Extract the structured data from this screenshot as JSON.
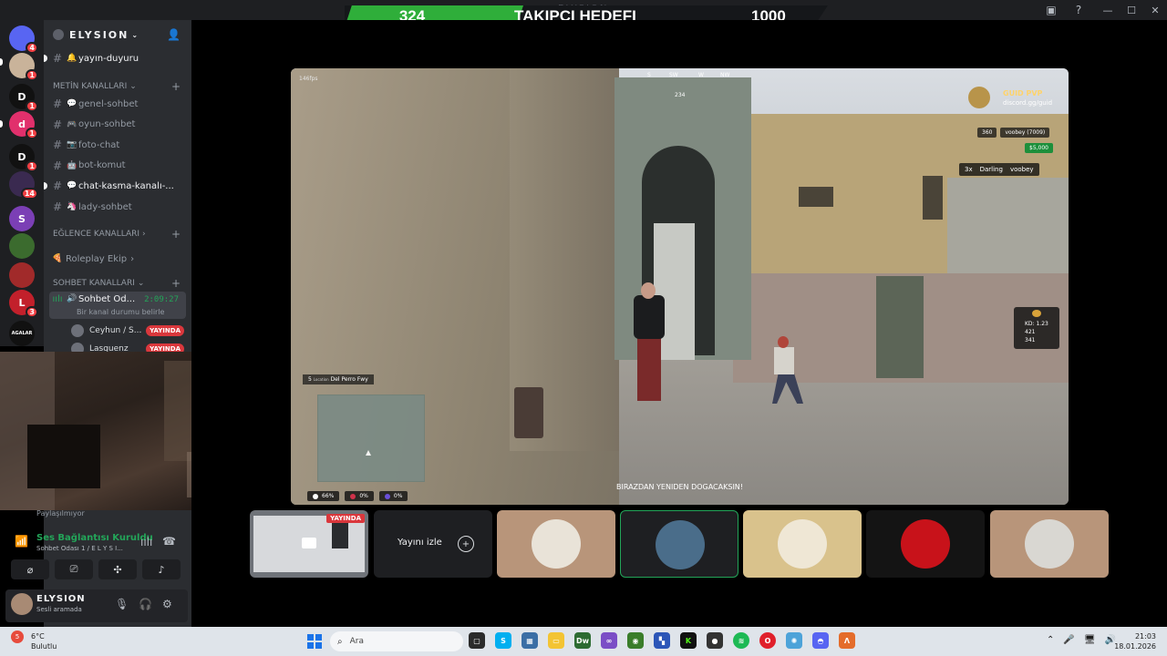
{
  "window": {
    "title_text": "ELYSION",
    "controls": [
      "—",
      "☐",
      "✕"
    ]
  },
  "overlay_goal": {
    "current": "324",
    "label": "TAKIPÇI HEDEFI",
    "target": "1000",
    "progress_fraction": 0.324,
    "fill_color": "#2fae3a"
  },
  "rail": {
    "items": [
      {
        "icon": "discord-icon",
        "badge": "4",
        "color": "#5865f2"
      },
      {
        "icon": "avatar",
        "badge": "1",
        "color": "#c9b39a"
      },
      {
        "icon": "server-d-yellow",
        "badge": "1",
        "color": "#111111",
        "text": "D"
      },
      {
        "icon": "server-tiktok",
        "badge": "1",
        "color": "#e1306c",
        "text": "d"
      },
      {
        "icon": "server-d-green",
        "badge": "1",
        "color": "#111111",
        "text": "D"
      },
      {
        "icon": "server-multi",
        "badge": "14",
        "color": "#3a2a50"
      },
      {
        "icon": "server-purple",
        "badge": "",
        "color": "#7b3fb5",
        "text": "S"
      },
      {
        "icon": "server-flower",
        "badge": "",
        "color": "#3b6b2e"
      },
      {
        "icon": "server-red-swirl",
        "badge": "",
        "color": "#a12a2a"
      },
      {
        "icon": "server-l",
        "badge": "3",
        "color": "#c2202b",
        "text": "L"
      },
      {
        "icon": "server-aga",
        "badge": "",
        "color": "#111111",
        "text": "AGALAR"
      }
    ]
  },
  "sidebar": {
    "server_name": "ELYSION",
    "announce_channel": "yayın-duyuru",
    "categories": {
      "text": "METİN KANALLARI",
      "fun": "EĞLENCE KANALLARI",
      "chat": "SOHBET KANALLARI"
    },
    "text_channels": [
      {
        "emoji": "💬",
        "name": "genel-sohbet",
        "unread": false
      },
      {
        "emoji": "🎮",
        "name": "oyun-sohbet",
        "unread": false
      },
      {
        "emoji": "📷",
        "name": "foto-chat",
        "unread": false
      },
      {
        "emoji": "🤖",
        "name": "bot-komut",
        "unread": false
      },
      {
        "emoji": "💬",
        "name": "chat-kasma-kanalı-...",
        "unread": true
      },
      {
        "emoji": "🦄",
        "name": "lady-sohbet",
        "unread": false
      }
    ],
    "roleplay_channel": "Roleplay Ekip",
    "voice_channel": {
      "name": "Sohbet Od...",
      "time": "2:09:27",
      "status": "Bir kanal durumu belirle"
    },
    "voice_users": [
      {
        "name": "Ceyhun / S...",
        "badge": "YAYINDA"
      },
      {
        "name": "Lasquenz",
        "badge": "YAYINDA"
      }
    ]
  },
  "user_area": {
    "share_status": "Paylaşılmıyor",
    "voice_connected": "Ses Bağlantısı Kuruldu",
    "voice_location": "Sohbet Odası 1 / E L Y S I...",
    "username": "ELYSION",
    "user_status": "Sesli aramada"
  },
  "stream": {
    "fps": "146fps",
    "compass": [
      "S",
      "SW",
      "W",
      "NW"
    ],
    "heading": "234",
    "guild_name": "GUID PVP",
    "guild_link": "discord.gg/guid",
    "chip_a": "360",
    "chip_b": "voobey (7009)",
    "cash": "$5,000",
    "squad_count": "3x",
    "squad_members": [
      "Darling",
      "voobey"
    ],
    "kd": "KD: 1.23",
    "kills": "421",
    "deaths": "341",
    "location_title": "Location",
    "location_name": "Del Perro Fwy",
    "location_num": "5",
    "subtitle": "BIRAZDAN YENIDEN DOGACAKSIN!",
    "vitals": [
      {
        "value": "66%",
        "color": "#ffffff"
      },
      {
        "value": "0%",
        "color": "#d0324a"
      },
      {
        "value": "0%",
        "color": "#6a4fd8"
      }
    ]
  },
  "tiles": {
    "share_live": "YAYINDA",
    "watch_label": "Yayını izle"
  },
  "taskbar": {
    "weather_badge": "5",
    "temperature": "6°C",
    "condition": "Bulutlu",
    "search_placeholder": "Ara",
    "time": "21:03",
    "date": "18.01.2026"
  }
}
